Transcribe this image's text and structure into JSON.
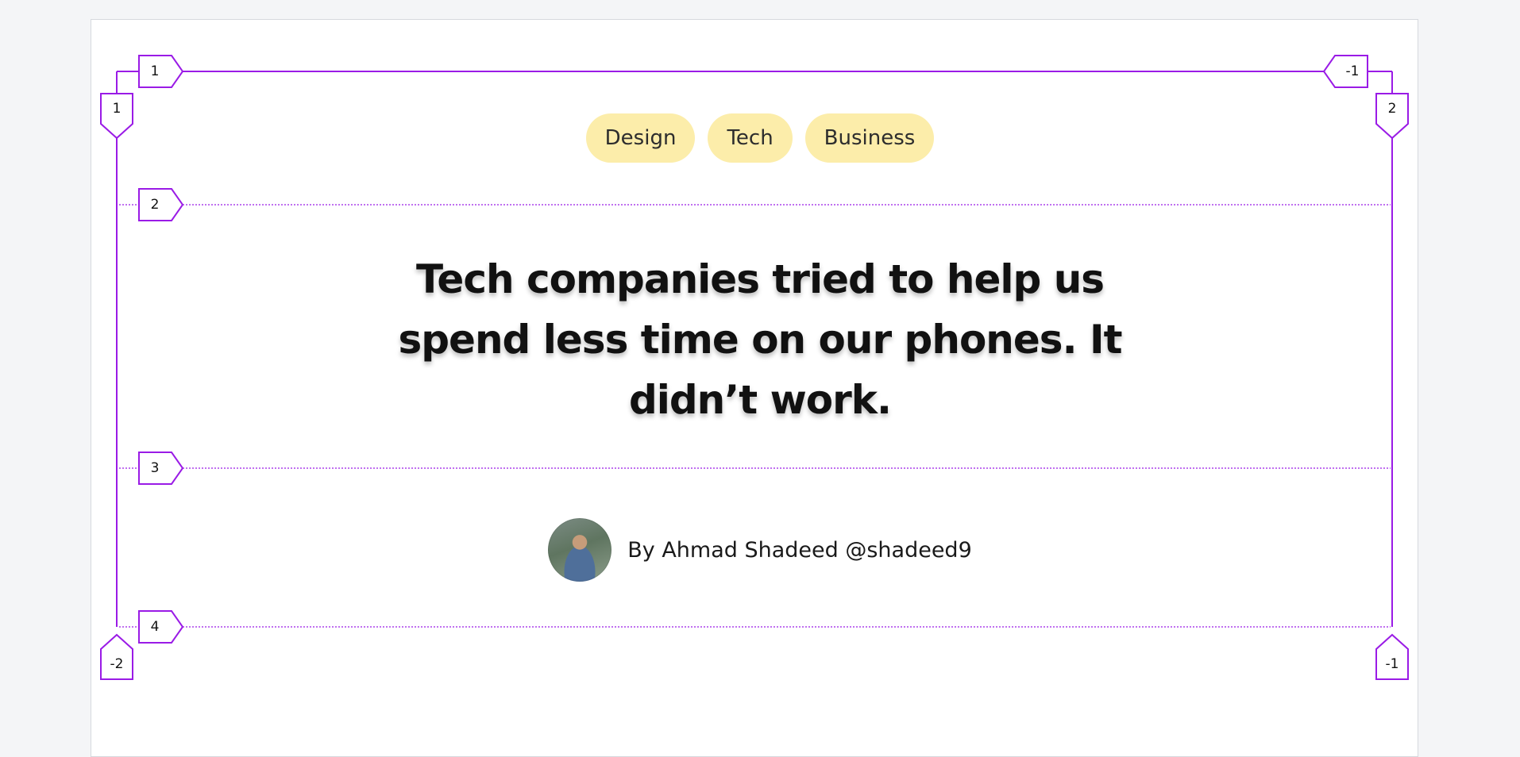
{
  "tags": [
    "Design",
    "Tech",
    "Business"
  ],
  "headline": "Tech companies tried to help us spend less time on our phones. It didn’t work.",
  "author": {
    "byline": "By Ahmad Shadeed @shadeed9"
  },
  "grid_overlay": {
    "column_line_labels_top": [
      "1",
      "-1"
    ],
    "column_line_labels_side": [
      "1",
      "2"
    ],
    "column_line_labels_bottom": [
      "-2",
      "-1"
    ],
    "row_line_labels": [
      "1",
      "2",
      "3",
      "4"
    ]
  },
  "colors": {
    "tag_background": "#fcedaa",
    "grid_overlay": "#9a1be6",
    "page_background": "#ffffff",
    "canvas_background": "#f4f5f7"
  }
}
